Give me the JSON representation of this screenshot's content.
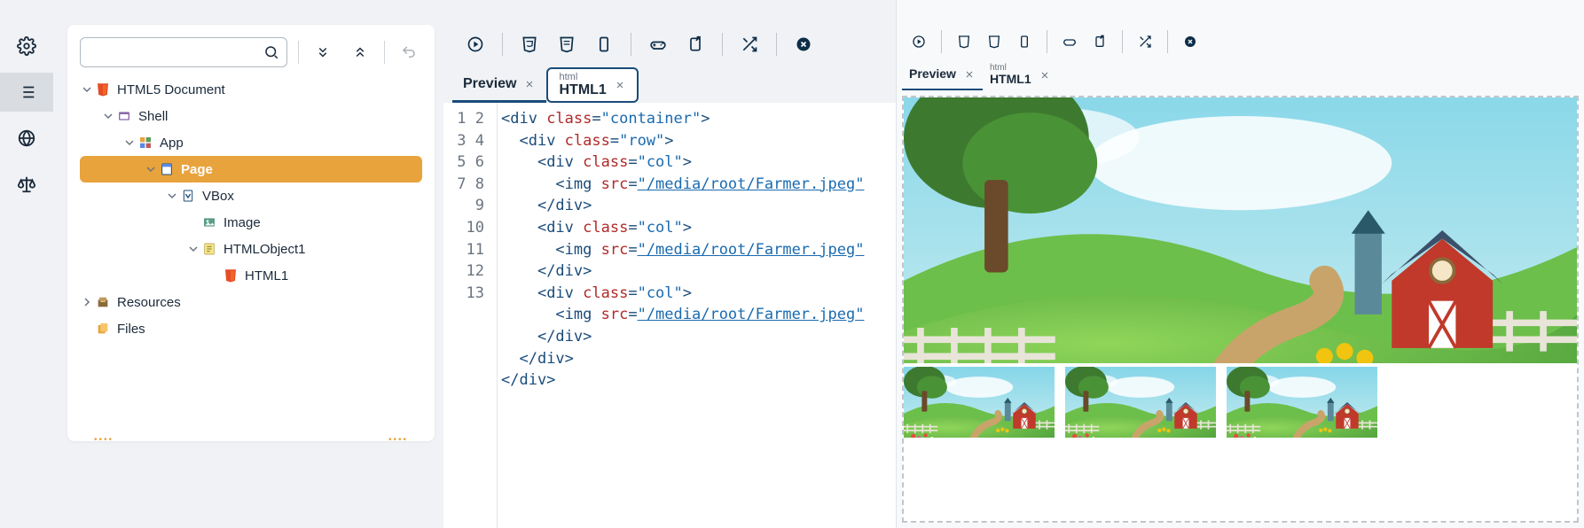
{
  "sidebar_rail": {
    "items": [
      "settings-icon",
      "list-icon",
      "globe-icon",
      "scales-icon"
    ],
    "active_index": 1
  },
  "left_panel": {
    "search_placeholder": "",
    "tree": [
      {
        "depth": 0,
        "caret": "down",
        "icon": "html5-icon",
        "label": "HTML5 Document",
        "bold": false
      },
      {
        "depth": 1,
        "caret": "down",
        "icon": "shell-icon",
        "label": "Shell",
        "bold": false
      },
      {
        "depth": 2,
        "caret": "down",
        "icon": "app-icon",
        "label": "App",
        "bold": false
      },
      {
        "depth": 3,
        "caret": "down",
        "icon": "page-icon",
        "label": "Page",
        "bold": true,
        "selected": true
      },
      {
        "depth": 4,
        "caret": "down",
        "icon": "vbox-icon",
        "label": "VBox",
        "bold": false
      },
      {
        "depth": 5,
        "caret": "none",
        "icon": "image-icon",
        "label": "Image",
        "bold": false
      },
      {
        "depth": 5,
        "caret": "down",
        "icon": "htmlobj-icon",
        "label": "HTMLObject1",
        "bold": false
      },
      {
        "depth": 6,
        "caret": "none",
        "icon": "html5-icon",
        "label": "HTML1",
        "bold": false
      },
      {
        "depth": 0,
        "caret": "right",
        "icon": "resources-icon",
        "label": "Resources",
        "bold": false
      },
      {
        "depth": 0,
        "caret": "none",
        "icon": "files-icon",
        "label": "Files",
        "bold": false
      }
    ]
  },
  "center_panel": {
    "tabs": [
      {
        "sup": "",
        "label": "Preview",
        "closable": true,
        "active_style": "plain"
      },
      {
        "sup": "html",
        "label": "HTML1",
        "closable": true,
        "active_style": "editor"
      }
    ],
    "code": {
      "lines": [
        {
          "n": 1,
          "indent": 0,
          "tokens": [
            [
              "tag",
              "<div "
            ],
            [
              "attr",
              "class"
            ],
            [
              "tag",
              "="
            ],
            [
              "str",
              "\"container\""
            ],
            [
              "tag",
              ">"
            ]
          ]
        },
        {
          "n": 2,
          "indent": 1,
          "tokens": [
            [
              "tag",
              "<div "
            ],
            [
              "attr",
              "class"
            ],
            [
              "tag",
              "="
            ],
            [
              "str",
              "\"row\""
            ],
            [
              "tag",
              ">"
            ]
          ]
        },
        {
          "n": 3,
          "indent": 2,
          "tokens": [
            [
              "tag",
              "<div "
            ],
            [
              "attr",
              "class"
            ],
            [
              "tag",
              "="
            ],
            [
              "str",
              "\"col\""
            ],
            [
              "tag",
              ">"
            ]
          ]
        },
        {
          "n": 4,
          "indent": 3,
          "tokens": [
            [
              "tag",
              "<img "
            ],
            [
              "attr",
              "src"
            ],
            [
              "tag",
              "="
            ],
            [
              "link",
              "\"/media/root/Farmer.jpeg\""
            ]
          ]
        },
        {
          "n": 5,
          "indent": 2,
          "tokens": [
            [
              "tag",
              "</div>"
            ]
          ]
        },
        {
          "n": 6,
          "indent": 2,
          "tokens": [
            [
              "tag",
              "<div "
            ],
            [
              "attr",
              "class"
            ],
            [
              "tag",
              "="
            ],
            [
              "str",
              "\"col\""
            ],
            [
              "tag",
              ">"
            ]
          ]
        },
        {
          "n": 7,
          "indent": 3,
          "tokens": [
            [
              "tag",
              "<img "
            ],
            [
              "attr",
              "src"
            ],
            [
              "tag",
              "="
            ],
            [
              "link",
              "\"/media/root/Farmer.jpeg\""
            ]
          ]
        },
        {
          "n": 8,
          "indent": 2,
          "tokens": [
            [
              "tag",
              "</div>"
            ]
          ]
        },
        {
          "n": 9,
          "indent": 2,
          "tokens": [
            [
              "tag",
              "<div "
            ],
            [
              "attr",
              "class"
            ],
            [
              "tag",
              "="
            ],
            [
              "str",
              "\"col\""
            ],
            [
              "tag",
              ">"
            ]
          ]
        },
        {
          "n": 10,
          "indent": 3,
          "tokens": [
            [
              "tag",
              "<img "
            ],
            [
              "attr",
              "src"
            ],
            [
              "tag",
              "="
            ],
            [
              "link",
              "\"/media/root/Farmer.jpeg\""
            ]
          ]
        },
        {
          "n": 11,
          "indent": 2,
          "tokens": [
            [
              "tag",
              "</div>"
            ]
          ]
        },
        {
          "n": 12,
          "indent": 1,
          "tokens": [
            [
              "tag",
              "</div>"
            ]
          ]
        },
        {
          "n": 13,
          "indent": 0,
          "tokens": [
            [
              "tag",
              "</div>"
            ]
          ]
        }
      ]
    }
  },
  "right_panel": {
    "tabs": [
      {
        "sup": "",
        "label": "Preview",
        "closable": true,
        "active_style": "plain"
      },
      {
        "sup": "html",
        "label": "HTML1",
        "closable": true,
        "active_style": "none"
      }
    ]
  },
  "toolbar_icons": [
    "play-icon",
    "css-icon",
    "css-icon",
    "device-icon",
    "gamepad-icon",
    "export-icon",
    "shuffle-icon",
    "close-circle-icon"
  ]
}
